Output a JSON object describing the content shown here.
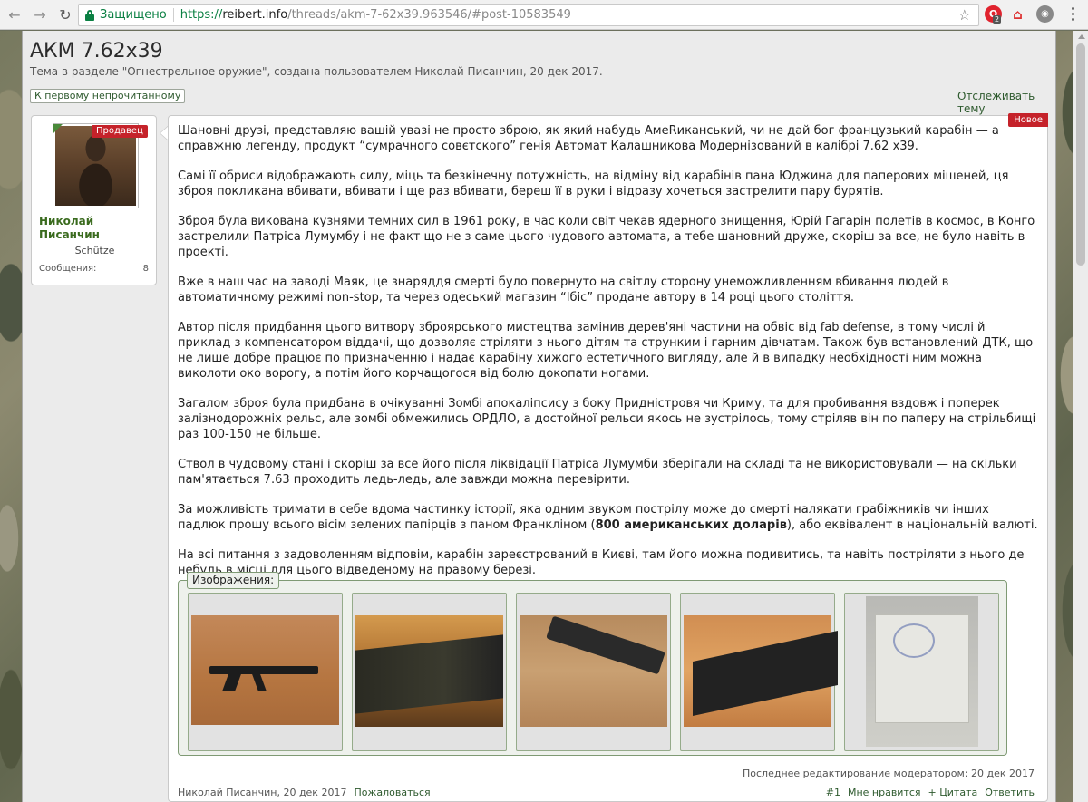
{
  "browser": {
    "secure_label": "Защищено",
    "url_scheme": "https://",
    "url_host": "reibert.info",
    "url_path": "/threads/akm-7-62x39.963546/#post-10583549",
    "ext_badge": "2"
  },
  "thread": {
    "title": "АКМ 7.62x39",
    "subtitle": "Тема в разделе \"Огнестрельное оружие\", создана пользователем Николай Писанчин, 20 дек 2017.",
    "first_unread_label": "К первому непрочитанному",
    "watch_label": "Отслеживать тему"
  },
  "user": {
    "ribbon": "Продавец",
    "name": "Николай Писанчин",
    "title": "Schütze",
    "stats_label": "Сообщения:",
    "stats_value": "8"
  },
  "message": {
    "new_badge": "Новое",
    "paragraphs": [
      "Шановні друзі, представляю вашій увазі не просто зброю, як який набудь АмеRиканський, чи не дай бог французький карабін — а справжню легенду, продукт “сумрачного совєтского” генія Автомат Калашникова Модернізований в калібрі 7.62 x39.",
      "Самі її обриси відображають силу, міць та безкінечну потужність, на відміну від карабінів пана Юджина для паперових мішеней, ця зброя покликана вбивати, вбивати і ще раз вбивати, береш її в руки і відразу хочеться застрелити пару бурятів.",
      "Зброя була викована кузнями темних сил в 1961 року, в час коли світ чекав ядерного знищення, Юрій Гагарін полетів в космос, в Конго застрелили Патріса Лумумбу і не факт що не з саме цього чудового автомата, а тебе шановний друже, скоріш за все, не було навіть в проекті.",
      "Вже в наш час на заводі Маяк, це знаряддя смерті було повернуто на світлу сторону унеможливленням вбивання людей в автоматичному режимі non-stop, та через одеський магазин “Ібіс” продане автору в 14 році цього століття.",
      "Автор після придбання цього витвору зброярського мистецтва замінив дерев'яні частини на обвіс від fab defense, в тому числі й приклад з компенсатором віддачі, що дозволяє стріляти з нього дітям та струнким і гарним дівчатам. Також був встановлений ДТК, що не лише добре працює по призначенню і надає карабіну хижого естетичного вигляду, але й в випадку необхідності ним можна виколоти око ворогу, а потім його корчащогося від болю докопати ногами.",
      "Загалом зброя була придбана в очікуванні Зомбі апокаліпсису з боку Придністровя чи Криму, та для пробивання вздовж і поперек залізнодорожніх рельс, але зомбі обмежились ОРДЛО, а достойної рельси якось не зустрілось, тому стріляв він по паперу на стрільбищі раз 100-150 не більше.",
      "Ствол в чудовому стані і скоріш за все його після ліквідації Патріса Лумумби зберігали на складі та не використовували — на скільки пам'ятається 7.63 проходить ледь-ледь, але завжди можна перевірити."
    ],
    "price_para_before": "За можливість тримати в себе вдома частинку історії, яка одним звуком пострілу може до смерті налякати грабіжників чи інших падлюк прошу всього вісім зелених папірців з паном Франкліном (",
    "price_para_strong": "800 американських доларів",
    "price_para_after": "), або еквівалент в національній валюті.",
    "last_para": "На всі питання з задоволенням відповім, карабін зареєстрований в Києві, там його можна подивитись, та навіть постріляти з нього де небудь в місці для цього відведеному на правому березі.",
    "attachments_label": "Изображения:",
    "edited": "Последнее редактирование модератором: 20 дек 2017",
    "footer_author_date": "Николай Писанчин, 20 дек 2017",
    "footer_report": "Пожаловаться",
    "footer_post_num": "#1",
    "footer_like": "Мне нравится",
    "footer_quote": "+ Цитата",
    "footer_reply": "Ответить"
  },
  "icons": {
    "back": "back-arrow-icon",
    "forward": "forward-arrow-icon",
    "reload": "reload-icon",
    "lock": "lock-icon",
    "star": "bookmark-star-icon",
    "menu": "menu-dots-icon"
  },
  "colors": {
    "accent_green": "#3a6b1e",
    "link_green": "#2e5a2e",
    "badge_red": "#c5222a",
    "secure_green": "#0b8043"
  }
}
